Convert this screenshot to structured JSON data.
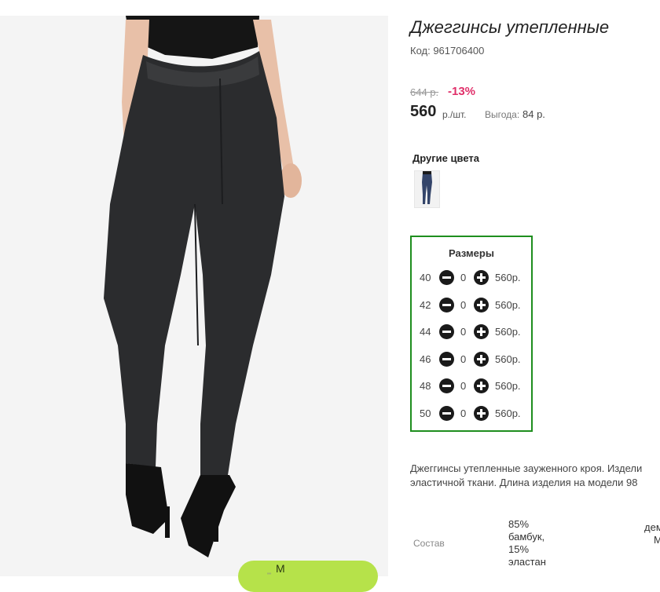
{
  "product": {
    "title": "Джеггинсы утепленные",
    "code": "Код: 961706400",
    "old_price": "644 р.",
    "discount": "-13%",
    "price": "560",
    "price_unit": "р./шт.",
    "savings_label": "Выгода:",
    "savings_value": "84 р."
  },
  "other_colors": {
    "label": "Другие цвета",
    "swatches": [
      {
        "icon": "jeggings-thumbnail-blue"
      }
    ]
  },
  "sizes": {
    "title": "Размеры",
    "rows": [
      {
        "size": "40",
        "qty": "0",
        "price": "560р."
      },
      {
        "size": "42",
        "qty": "0",
        "price": "560р."
      },
      {
        "size": "44",
        "qty": "0",
        "price": "560р."
      },
      {
        "size": "46",
        "qty": "0",
        "price": "560р."
      },
      {
        "size": "48",
        "qty": "0",
        "price": "560р."
      },
      {
        "size": "50",
        "qty": "0",
        "price": "560р."
      }
    ],
    "border_color": "#1e8e1e"
  },
  "description": {
    "line1": "Джеггинсы утепленные зауженного кроя. Издели",
    "line2": "эластичной ткани. Длина изделия на модели 98"
  },
  "composition": {
    "label": "Состав",
    "value_lines": [
      "85%",
      "бамбук,",
      "15%",
      "эластан"
    ],
    "extra_lines": [
      "дем",
      "М"
    ]
  },
  "cart_button": {
    "label": "М",
    "color": "#b6e24a"
  },
  "misc": {
    "mark": "'''"
  }
}
